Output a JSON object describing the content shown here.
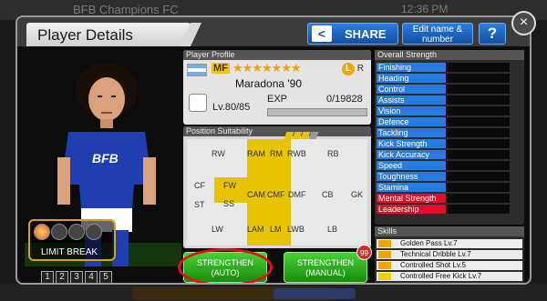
{
  "background": {
    "club_name": "BFB Champions FC",
    "clock": "12:36 PM"
  },
  "header": {
    "title": "Player Details",
    "share_label": "SHARE",
    "edit_label": "Edit name & number",
    "help_label": "?",
    "close_label": "×"
  },
  "player_card": {
    "limit_break_label": "LIMIT BREAK",
    "limit_break_filled": 1,
    "limit_break_total": 4,
    "page_numbers": [
      "1",
      "2",
      "3",
      "4",
      "5"
    ]
  },
  "profile": {
    "section_label": "Player Profile",
    "position": "MF",
    "stars": "★★★★★★★",
    "name": "Maradona '90",
    "foot": "L",
    "foot_alt": "R",
    "level": "Lv.80/85",
    "exp_label": "EXP",
    "exp_value": "0/19828"
  },
  "positions": {
    "section_label": "Position Suitability",
    "cells": [
      "RW",
      "RAM",
      "RM",
      "RWB",
      "RB",
      "CF",
      "FW",
      "CAM",
      "CMF",
      "DMF",
      "CB",
      "GK",
      "ST",
      "SS",
      "LW",
      "LAM",
      "LM",
      "LWB",
      "LB"
    ]
  },
  "buttons": {
    "auto": "STRENGTHEN (AUTO)",
    "manual": "STRENGTHEN (MANUAL)",
    "manual_badge": "99"
  },
  "strength": {
    "section_label": "Overall Strength",
    "stats": [
      {
        "label": "Finishing",
        "color": "#2a7be0"
      },
      {
        "label": "Heading",
        "color": "#2a7be0"
      },
      {
        "label": "Control",
        "color": "#2a7be0"
      },
      {
        "label": "Assists",
        "color": "#2a7be0"
      },
      {
        "label": "Vision",
        "color": "#2a7be0"
      },
      {
        "label": "Defence",
        "color": "#2a7be0"
      },
      {
        "label": "Tackling",
        "color": "#2a7be0"
      },
      {
        "label": "Kick Strength",
        "color": "#2a7be0"
      },
      {
        "label": "Kick Accuracy",
        "color": "#2a7be0"
      },
      {
        "label": "Speed",
        "color": "#2a7be0"
      },
      {
        "label": "Toughness",
        "color": "#2a7be0"
      },
      {
        "label": "Stamina",
        "color": "#2a7be0"
      },
      {
        "label": "Mental Strength",
        "color": "#e0102a"
      },
      {
        "label": "Leadership",
        "color": "#e0102a"
      }
    ]
  },
  "skills": {
    "section_label": "Skills",
    "items": [
      "Golden Pass Lv.7",
      "Technical Dribble Lv.7",
      "Controlled Shot Lv.5",
      "Controlled Free Kick Lv.7"
    ]
  }
}
